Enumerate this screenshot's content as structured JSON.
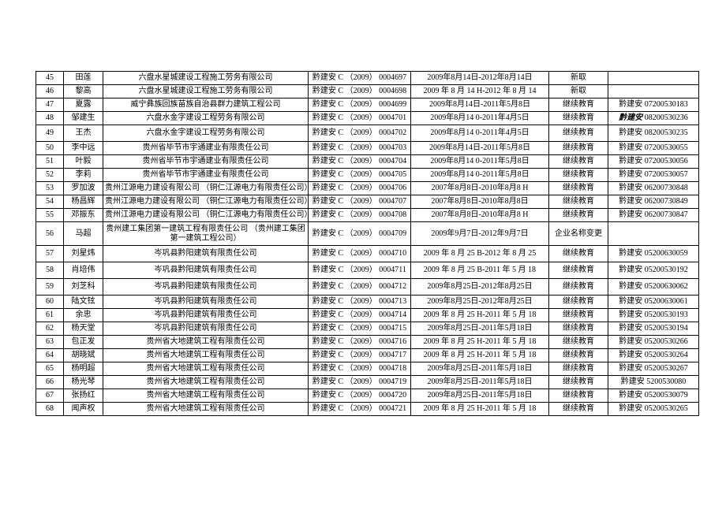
{
  "rows": [
    {
      "no": "45",
      "name": "田莲",
      "company": "六盘水星城建设工程施工劳务有限公司",
      "cert": "黔建安 C （2009） 0004697",
      "period": "2009年8月14日-2012年8月14日",
      "status": "新取",
      "ref": ""
    },
    {
      "no": "46",
      "name": "黎高",
      "company": "六盘水星城建设工程施工劳务有限公司",
      "cert": "黔建安 C （2009） 0004698",
      "period": "2009 年 8 月 14 H-2012 年 8 月 14",
      "status": "新取",
      "ref": ""
    },
    {
      "no": "47",
      "name": "夏露",
      "company": "威宁彝族回族苗族自治县群力建筑工程公司",
      "cert": "黔建安 C （2009） 0004699",
      "period": "2009年8月14日-2011年5月8日",
      "status": "继续教育",
      "ref": "黔建安 07200530183"
    },
    {
      "no": "48",
      "name": "邹建生",
      "company": "六盘水金字建设工程劳务有限公司",
      "cert": "黔建安 C （2009） 0004701",
      "period": "2009年8月14 0-2011年4月5日",
      "status": "继续教育",
      "ref": "黔建安 08200530236",
      "bold_ref_prefix": true
    },
    {
      "no": "49",
      "name": "王杰",
      "company": "六盘水金字建设工程劳务有限公司",
      "cert": "黔建安 C （2009） 0004702",
      "period": "2009年8月14 0-2011年4月5日",
      "status": "继续教育",
      "ref": "黔建安 08200530235"
    },
    {
      "no": "50",
      "name": "李中远",
      "company": "贵州省毕节市宇通建业有限责任公司",
      "cert": "黔建安 C （2009） 0004703",
      "period": "2009年8月14日-2011年5月8日",
      "status": "继续教育",
      "ref": "黔建安 07200530055"
    },
    {
      "no": "51",
      "name": "叶毅",
      "company": "贵州省毕节市宇通建业有限责任公司",
      "cert": "黔建安 C （2009） 0004704",
      "period": "2009年8月14 0-2011年5月8日",
      "status": "继续教育",
      "ref": "黔建安 07200530056"
    },
    {
      "no": "52",
      "name": "李莉",
      "company": "贵州省毕节市宇通建业有限责任公司",
      "cert": "黔建安 C （2009） 0004705",
      "period": "2009年8月14 0-2011年5月8日",
      "status": "继续教育",
      "ref": "黔建安 07200530057"
    },
    {
      "no": "53",
      "name": "罗加波",
      "company": "贵州江源电力建设有限公司 （铜仁江源电力有限责任公司）",
      "cert": "黔建安 C （2009） 0004706",
      "period": "2007年8月8日-2010年8月8 H",
      "status": "继续教育",
      "ref": "黔建安 06200730848"
    },
    {
      "no": "54",
      "name": "杨昌辉",
      "company": "贵州江源电力建设有限公司 （铜仁江源电力有限责任公司）",
      "cert": "黔建安 C （2009） 0004707",
      "period": "2007年8月8日-2010年8月8日",
      "status": "继续教育",
      "ref": "黔建安 06200730849"
    },
    {
      "no": "55",
      "name": "邓振东",
      "company": "贵州江源电力建设有限公司 （铜仁江源电力有限责任公司）",
      "cert": "黔建安 C （2009） 0004708",
      "period": "2007年8月8日-2010年8月8 H",
      "status": "继续教育",
      "ref": "黔建安 06200730847"
    },
    {
      "no": "56",
      "name": "马超",
      "company": "贵州建工集团第一建筑工程有限责任公司 （贵州建工集团第一建筑工程公司）",
      "cert": "黔建安 C （2009） 0004709",
      "period": "2009年9月7日-2012年9月7日",
      "status": "企业名称变更",
      "ref": "",
      "tall": true
    },
    {
      "no": "57",
      "name": "刘星炜",
      "company": "岑巩县黔阳建筑有限责任公司",
      "cert": "黔建安 C （2009） 0004710",
      "period": "2009 年 8 月 25 B-2012 年 8 月 25",
      "status": "继续教育",
      "ref": "黔建安 05200630059"
    },
    {
      "no": "58",
      "name": "肖培伟",
      "company": "岑巩县黔阳建筑有限责任公司",
      "cert": "黔建安 C （2009） 0004711",
      "period": "2009 年 8 月 25 B-2011 年 5 月 18",
      "status": "继续教育",
      "ref": "黔建安 05200530192"
    },
    {
      "no": "59",
      "name": "刘芝科",
      "company": "岑巩县黔阳建筑有限责任公司",
      "cert": "黔建安 C （2009） 0004712",
      "period": "2009年8月25日-2012年8月25日",
      "status": "继续教育",
      "ref": "黔建安 05200630062"
    },
    {
      "no": "60",
      "name": "陆文铉",
      "company": "岑巩县黔阳建筑有限责任公司",
      "cert": "黔建安 C （2009） 0004713",
      "period": "2009年8月25日-2012年8月25日",
      "status": "继续教育",
      "ref": "黔建安 05200630061"
    },
    {
      "no": "61",
      "name": "余忠",
      "company": "岑巩县黔阳建筑有限责任公司",
      "cert": "黔建安 C （2009） 0004714",
      "period": "2009 年 8 月 25 H-2011 年 5 月 18",
      "status": "继续教育",
      "ref": "黔建安 05200530193"
    },
    {
      "no": "62",
      "name": "杨天堂",
      "company": "岑巩县黔阳建筑有限责任公司",
      "cert": "黔建安 C （2009） 0004715",
      "period": "2009年8月25日-2011年5月18日",
      "status": "继续教育",
      "ref": "黔建安 05200530194"
    },
    {
      "no": "63",
      "name": "包正发",
      "company": "贵州省大地建筑工程有限责任公司",
      "cert": "黔建安 C （2009） 0004716",
      "period": "2009 年 8 月 25 H-2011 年 5 月 18",
      "status": "继续教育",
      "ref": "黔建安 05200530266"
    },
    {
      "no": "64",
      "name": "胡晓斌",
      "company": "贵州省大地建筑工程有限责任公司",
      "cert": "黔建安 C （2009） 0004717",
      "period": "2009 年 8 月 25 H-2011 年 5 月 18",
      "status": "继续教育",
      "ref": "黔建安 05200530264"
    },
    {
      "no": "65",
      "name": "杨明超",
      "company": "贵州省大地建筑工程有限责任公司",
      "cert": "黔建安 C （2009） 0004718",
      "period": "2009年8月25日-2011年5月18日",
      "status": "继续教育",
      "ref": "黔建安 05200530267"
    },
    {
      "no": "66",
      "name": "杨光琴",
      "company": "贵州省大地建筑工程有限责任公司",
      "cert": "黔建安 C （2009） 0004719",
      "period": "2009年8月25日-2011年5月18日",
      "status": "继续教育",
      "ref": "黔建安 5200530080"
    },
    {
      "no": "67",
      "name": "张扬红",
      "company": "贵州省大地建筑工程有限责任公司",
      "cert": "黔建安 C （2009） 0004720",
      "period": "2009年8月25日-2011年5月18日",
      "status": "继续教育",
      "ref": "黔建安 05200530079"
    },
    {
      "no": "68",
      "name": "闻声权",
      "company": "贵州省大地建筑工程有限责任公司",
      "cert": "黔建安 C （2009） 0004721",
      "period": "2009 年 8 月 25 H-2011 年 5 月 18",
      "status": "继续教育",
      "ref": "黔建安 05200530265"
    }
  ]
}
